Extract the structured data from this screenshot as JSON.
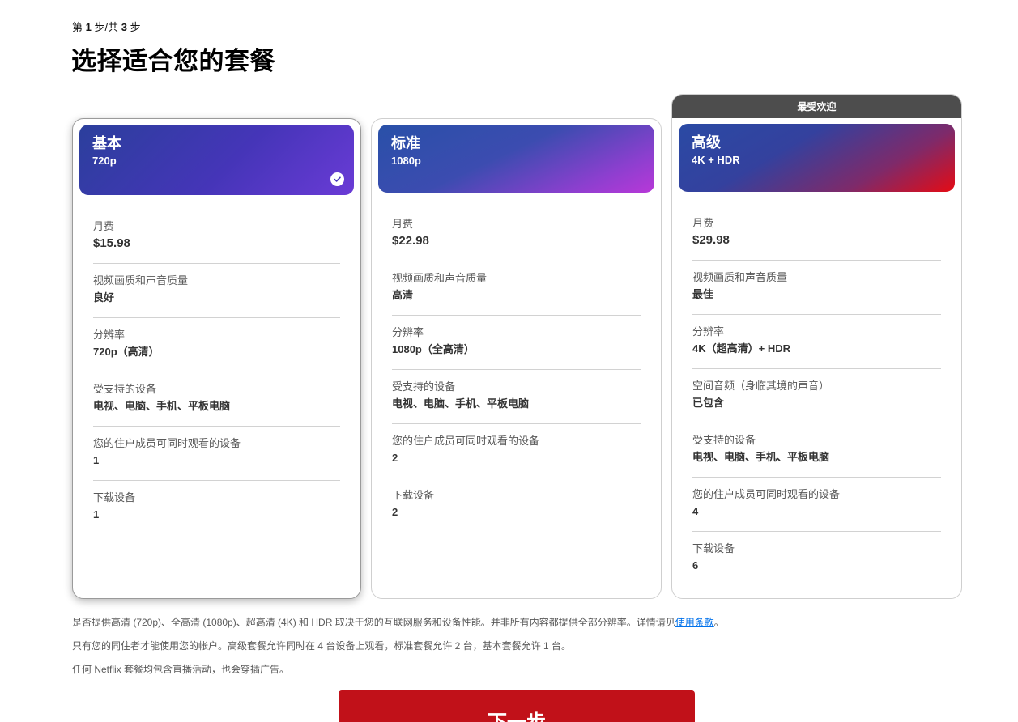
{
  "header": {
    "step_prefix": "第",
    "step_current": "1",
    "step_mid": "步/共",
    "step_total": "3",
    "step_suffix": "步",
    "title": "选择适合您的套餐"
  },
  "colors": {
    "netflix_red": "#c11119",
    "link_blue": "#0071eb",
    "popular_bar": "#4d4d4d"
  },
  "plans": [
    {
      "name": "基本",
      "resolution": "720p",
      "selected": true,
      "badge": "",
      "rows": [
        {
          "label": "月费",
          "value": "$15.98"
        },
        {
          "label": "视频画质和声音质量",
          "value": "良好"
        },
        {
          "label": "分辨率",
          "value": "720p（高清）"
        },
        {
          "label": "受支持的设备",
          "value": "电视、电脑、手机、平板电脑"
        },
        {
          "label": "您的住户成员可同时观看的设备",
          "value": "1"
        },
        {
          "label": "下载设备",
          "value": "1"
        }
      ]
    },
    {
      "name": "标准",
      "resolution": "1080p",
      "selected": false,
      "badge": "",
      "rows": [
        {
          "label": "月费",
          "value": "$22.98"
        },
        {
          "label": "视频画质和声音质量",
          "value": "高清"
        },
        {
          "label": "分辨率",
          "value": "1080p（全高清）"
        },
        {
          "label": "受支持的设备",
          "value": "电视、电脑、手机、平板电脑"
        },
        {
          "label": "您的住户成员可同时观看的设备",
          "value": "2"
        },
        {
          "label": "下载设备",
          "value": "2"
        }
      ]
    },
    {
      "name": "高级",
      "resolution": "4K + HDR",
      "selected": false,
      "badge": "最受欢迎",
      "rows": [
        {
          "label": "月费",
          "value": "$29.98"
        },
        {
          "label": "视频画质和声音质量",
          "value": "最佳"
        },
        {
          "label": "分辨率",
          "value": "4K（超高清）+ HDR"
        },
        {
          "label": "空间音频（身临其境的声音）",
          "value": "已包含"
        },
        {
          "label": "受支持的设备",
          "value": "电视、电脑、手机、平板电脑"
        },
        {
          "label": "您的住户成员可同时观看的设备",
          "value": "4"
        },
        {
          "label": "下载设备",
          "value": "6"
        }
      ]
    }
  ],
  "notes": {
    "note1_text": "是否提供高清 (720p)、全高清 (1080p)、超高清 (4K) 和 HDR 取决于您的互联网服务和设备性能。并非所有内容都提供全部分辨率。详情请见",
    "note1_link": "使用条款",
    "note1_end": "。",
    "note2": "只有您的同住者才能使用您的帐户。高级套餐允许同时在 4 台设备上观看，标准套餐允许 2 台，基本套餐允许 1 台。",
    "note3": "任何 Netflix 套餐均包含直播活动，也会穿插广告。"
  },
  "actions": {
    "next_label": "下一步"
  }
}
